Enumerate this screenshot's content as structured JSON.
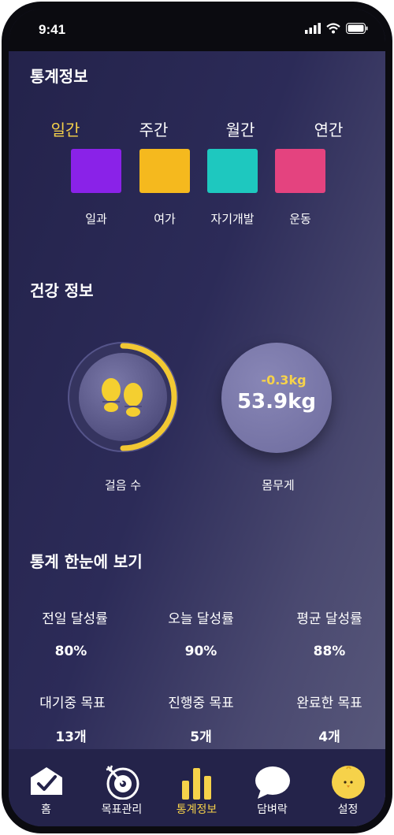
{
  "status_bar": {
    "time": "9:41"
  },
  "stats_section": {
    "title": "통계정보",
    "tabs": [
      {
        "label": "일간",
        "active": true
      },
      {
        "label": "주간",
        "active": false
      },
      {
        "label": "월간",
        "active": false
      },
      {
        "label": "연간",
        "active": false
      }
    ],
    "categories": [
      {
        "label": "일과",
        "color": "#8a22e8"
      },
      {
        "label": "여가",
        "color": "#f5b91e"
      },
      {
        "label": "자기개발",
        "color": "#1ec8bf"
      },
      {
        "label": "운동",
        "color": "#e4437f"
      }
    ]
  },
  "health_section": {
    "title": "건강 정보",
    "steps": {
      "label": "걸음 수"
    },
    "weight": {
      "label": "몸무게",
      "value": "53.9kg",
      "change": "-0.3kg"
    }
  },
  "summary_section": {
    "title": "통계 한눈에 보기",
    "items": [
      {
        "label": "전일 달성률",
        "value": "80%"
      },
      {
        "label": "오늘 달성률",
        "value": "90%"
      },
      {
        "label": "평균 달성률",
        "value": "88%"
      },
      {
        "label": "대기중 목표",
        "value": "13개"
      },
      {
        "label": "진행중 목표",
        "value": "5개"
      },
      {
        "label": "완료한 목표",
        "value": "4개"
      }
    ]
  },
  "tab_bar": {
    "items": [
      {
        "label": "홈",
        "icon": "home-check-icon",
        "active": false
      },
      {
        "label": "목표관리",
        "icon": "target-icon",
        "active": false
      },
      {
        "label": "통계정보",
        "icon": "bar-chart-icon",
        "active": true
      },
      {
        "label": "담벼락",
        "icon": "chat-bubble-icon",
        "active": false
      },
      {
        "label": "설정",
        "icon": "chick-avatar-icon",
        "active": false
      }
    ]
  },
  "colors": {
    "accent": "#f6d24a",
    "background": "#2c2b58"
  }
}
